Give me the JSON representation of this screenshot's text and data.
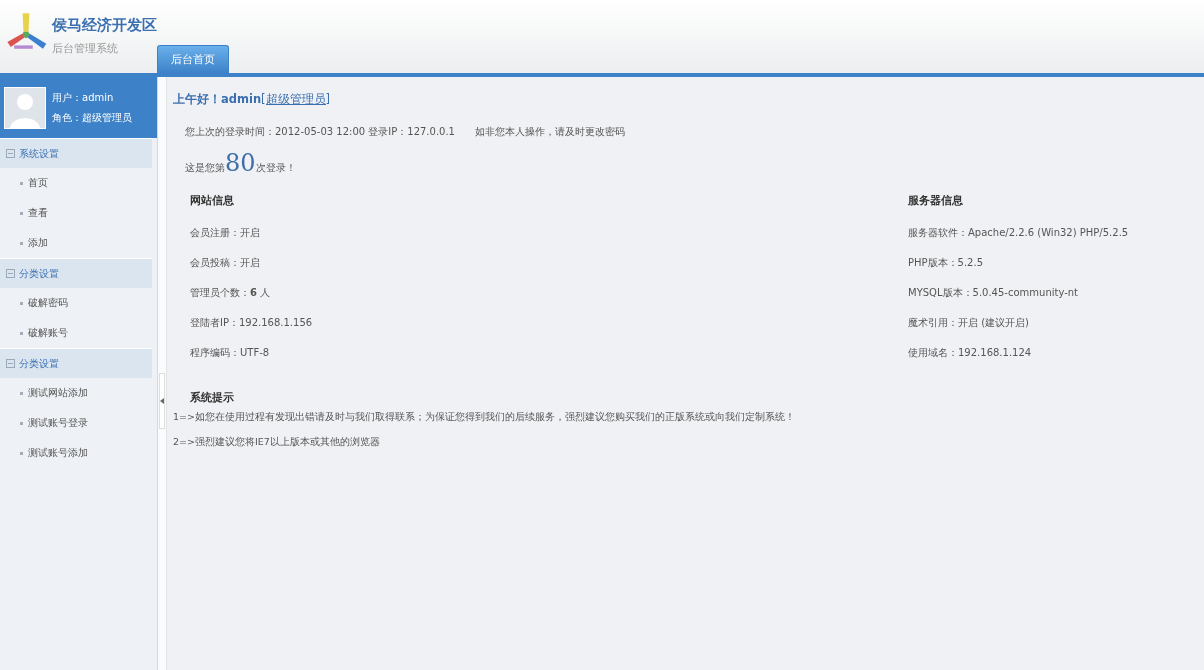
{
  "header": {
    "title": "侯马经济开发区",
    "subtitle": "后台管理系统"
  },
  "tabs": [
    {
      "label": "后台首页",
      "selected": true
    }
  ],
  "user": {
    "name_line": "用户：admin",
    "role_line": "角色：超级管理员"
  },
  "sidebar": {
    "groups": [
      {
        "label": "系统设置",
        "expanded": true,
        "children": [
          {
            "label": "首页"
          },
          {
            "label": "查看"
          },
          {
            "label": "添加"
          }
        ]
      },
      {
        "label": "分类设置",
        "expanded": true,
        "children": [
          {
            "label": "破解密码"
          },
          {
            "label": "破解账号"
          }
        ]
      },
      {
        "label": "分类设置",
        "expanded": true,
        "children": [
          {
            "label": "测试网站添加"
          },
          {
            "label": "测试账号登录"
          },
          {
            "label": "测试账号添加"
          }
        ]
      }
    ]
  },
  "greeting": {
    "text": "上午好！admin",
    "role_link": "[超级管理员]"
  },
  "last_login": {
    "text": "您上次的登录时间：2012-05-03 12:00 登录IP：127.0.0.1",
    "warning": "如非您本人操作，请及时更改密码"
  },
  "login_count": {
    "prefix": "这是您第",
    "count": "80",
    "suffix": "次登录！"
  },
  "site_info": {
    "title": "网站信息",
    "items": [
      "会员注册：开启",
      "会员投稿：开启",
      "管理员个数：**6** 人",
      "登陆者IP：192.168.1.156",
      "程序编码：UTF-8"
    ]
  },
  "server_info": {
    "title": "服务器信息",
    "items": [
      "服务器软件：Apache/2.2.6 (Win32) PHP/5.2.5",
      "PHP版本：5.2.5",
      "MYSQL版本：5.0.45-community-nt",
      "魔术引用：开启 (建议开启)",
      "使用域名：192.168.1.124"
    ]
  },
  "tips": {
    "title": "系统提示",
    "lines": [
      "1=>如您在使用过程有发现出错请及时与我们取得联系；为保证您得到我们的后续服务，强烈建议您购买我们的正版系统或向我们定制系统！",
      "2=>强烈建议您将IE7以上版本或其他的浏览器"
    ]
  }
}
